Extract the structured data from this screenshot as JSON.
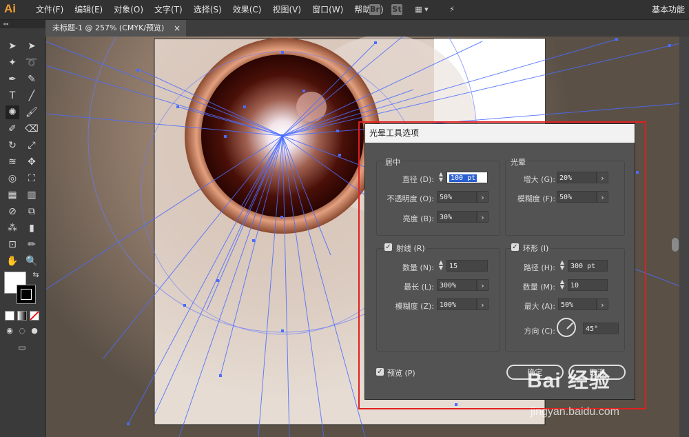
{
  "app": {
    "logo": "Ai",
    "menus": [
      "文件(F)",
      "编辑(E)",
      "对象(O)",
      "文字(T)",
      "选择(S)",
      "效果(C)",
      "视图(V)",
      "窗口(W)",
      "帮助(H)"
    ],
    "bar_icons": [
      "Br",
      "St"
    ],
    "workspace": "基本功能"
  },
  "document_tab": {
    "title": "未标题-1 @ 257% (CMYK/预览)",
    "close": "×"
  },
  "dialog": {
    "title": "光晕工具选项",
    "center_group": {
      "label": "居中",
      "diameter": {
        "label": "直径 (D):",
        "value": "100 pt"
      },
      "opacity": {
        "label": "不透明度 (O):",
        "value": "50%"
      },
      "brightness": {
        "label": "亮度 (B):",
        "value": "30%"
      }
    },
    "halo_group": {
      "label": "光晕",
      "growth": {
        "label": "增大 (G):",
        "value": "20%"
      },
      "fuzziness": {
        "label": "模糊度 (F):",
        "value": "50%"
      }
    },
    "rays_group": {
      "label": "射线 (R)",
      "checked": true,
      "number": {
        "label": "数量 (N):",
        "value": "15"
      },
      "longest": {
        "label": "最长 (L):",
        "value": "300%"
      },
      "fuzziness": {
        "label": "模糊度 (Z):",
        "value": "100%"
      }
    },
    "rings_group": {
      "label": "环形 (I)",
      "checked": true,
      "path": {
        "label": "路径 (H):",
        "value": "300 pt"
      },
      "number": {
        "label": "数量 (M):",
        "value": "10"
      },
      "largest": {
        "label": "最大 (A):",
        "value": "50%"
      },
      "direction": {
        "label": "方向 (C):",
        "value": "45°"
      }
    },
    "preview": {
      "label": "预览 (P)",
      "checked": true
    },
    "ok_label": "确定",
    "cancel_label": "取消"
  },
  "watermark": {
    "brand": "Bai 经验",
    "url": "jingyan.baidu.com"
  },
  "colors": {
    "accent_logo": "#f0a030",
    "highlight_border": "#e02020",
    "flare_ring": "#c07850",
    "flare_core": "#3a0a05",
    "handle_line": "#4a6cff"
  }
}
